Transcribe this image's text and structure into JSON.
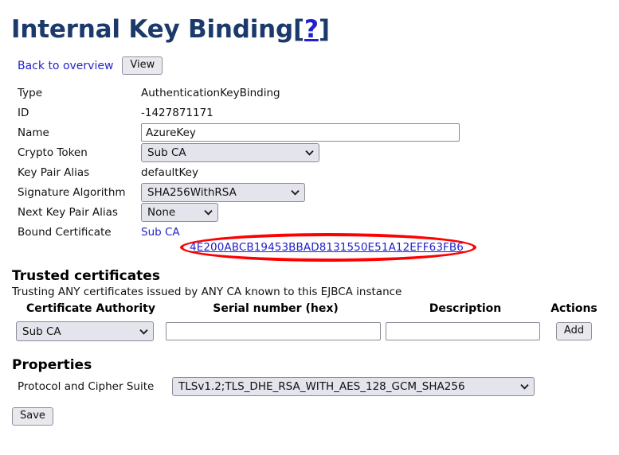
{
  "page": {
    "title": "Internal Key Binding",
    "help_bracket_open": "[",
    "help_symbol": "?",
    "help_bracket_close": "]"
  },
  "nav": {
    "back_link": "Back to overview",
    "view_button": "View"
  },
  "details": {
    "rows": [
      {
        "label": "Type",
        "value": "AuthenticationKeyBinding"
      },
      {
        "label": "ID",
        "value": "-1427871171"
      },
      {
        "label": "Name",
        "value": "AzureKey"
      },
      {
        "label": "Crypto Token",
        "value": "Sub CA"
      },
      {
        "label": "Key Pair Alias",
        "value": "defaultKey"
      },
      {
        "label": "Signature Algorithm",
        "value": "SHA256WithRSA"
      },
      {
        "label": "Next Key Pair Alias",
        "value": "None"
      },
      {
        "label": "Bound Certificate",
        "value": "Sub CA"
      }
    ],
    "name_placeholder": "",
    "bound_certificate_ca": "Sub CA",
    "bound_certificate_serial": "4E200ABCB19453BBAD8131550E51A12EFF63FB6"
  },
  "trusted": {
    "heading": "Trusted certificates",
    "subtitle": "Trusting ANY certificates issued by ANY CA known to this EJBCA instance",
    "columns": [
      "Certificate Authority",
      "Serial number (hex)",
      "Description",
      "Actions"
    ],
    "row": {
      "ca_value": "Sub CA",
      "serial_value": "",
      "serial_placeholder": "",
      "description_value": "",
      "description_placeholder": "",
      "add_button": "Add"
    }
  },
  "properties": {
    "heading": "Properties",
    "protocol_label": "Protocol and Cipher Suite",
    "protocol_value": "TLSv1.2;TLS_DHE_RSA_WITH_AES_128_GCM_SHA256"
  },
  "actions": {
    "save_button": "Save"
  },
  "colors": {
    "title": "#1b3a6b",
    "link": "#2424cc",
    "annotation": "#ff0000",
    "select_bg": "#e4e4ec"
  }
}
